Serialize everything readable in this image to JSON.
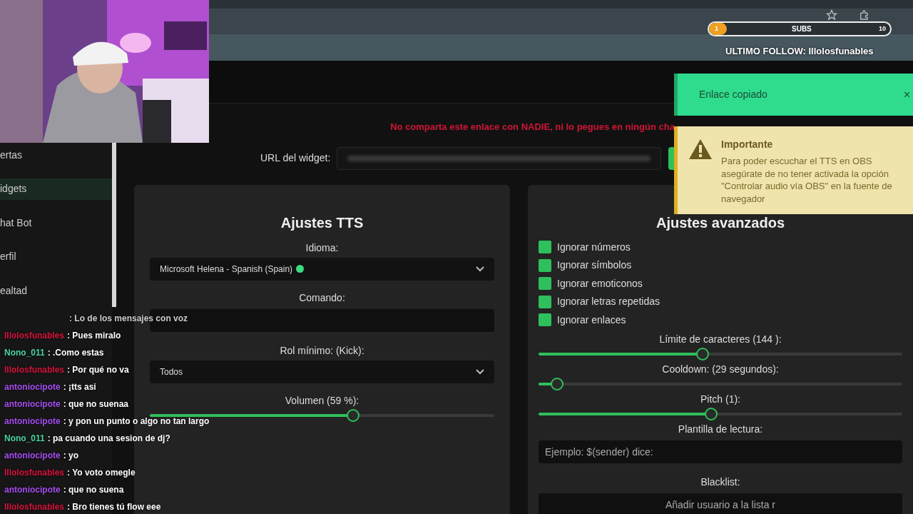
{
  "stream_overlay": {
    "subs": {
      "current": "1",
      "label": "SUBS",
      "goal": "10",
      "level": 0.1
    },
    "last_follow": "ULTIMO FOLLOW: Illolosfunables"
  },
  "sidebar": {
    "items": [
      {
        "label": "ertas",
        "selected": false
      },
      {
        "label": "idgets",
        "selected": true
      },
      {
        "label": "hat Bot",
        "selected": false
      },
      {
        "label": "erfil",
        "selected": false
      },
      {
        "label": "ealtad",
        "selected": false
      }
    ]
  },
  "warning_text": "No comparta este enlace con NADIE, ni lo pegues en ningún cha",
  "url_row": {
    "label": "URL del widget:"
  },
  "toasts": [
    {
      "kind": "success",
      "text": "Enlace copiado",
      "close": "×"
    },
    {
      "kind": "warning",
      "title": "Importante",
      "text": "Para poder escuchar el TTS en OBS asegúrate de no tener activada la opción \"Controlar audio vía OBS\" en la fuente de navegador"
    }
  ],
  "tts_card": {
    "title": "Ajustes TTS",
    "fields": [
      {
        "kind": "select",
        "label": "Idioma:",
        "value": "Microsoft Helena - Spanish (Spain)",
        "color": "#3ddc84"
      },
      {
        "kind": "input",
        "label": "Comando:"
      },
      {
        "kind": "select",
        "label": "Rol mínimo: (Kick):",
        "value": "Todos"
      },
      {
        "kind": "slider",
        "label": "Volumen (59 %):",
        "level": 0.59
      }
    ]
  },
  "advanced_card": {
    "title": "Ajustes avanzados",
    "options": [
      {
        "label": "Ignorar números",
        "checked": true
      },
      {
        "label": "Ignorar símbolos",
        "checked": true
      },
      {
        "label": "Ignorar emoticonos",
        "checked": true
      },
      {
        "label": "Ignorar letras repetidas",
        "checked": true
      },
      {
        "label": "Ignorar enlaces",
        "checked": true
      }
    ],
    "fields": [
      {
        "kind": "slider",
        "label": "Límite de caracteres (144 ):",
        "level": 0.45
      },
      {
        "kind": "slider",
        "label": "Cooldown: (29 segundos):",
        "level": 0.05
      },
      {
        "kind": "slider",
        "label": "Pitch (1):",
        "level": 0.475
      },
      {
        "kind": "input",
        "label": "Plantilla de lectura:",
        "placeholder": "Ejemplo: $(sender) dice:"
      },
      {
        "kind": "list_input",
        "label": "Blacklist:",
        "placeholder": "Añadir usuario a la lista r"
      }
    ]
  },
  "chat": [
    {
      "text": ": Lo de los mensajes con voz"
    },
    {
      "user": "Illolosfunables",
      "color": "#d8143e",
      "text": ": Pues miralo"
    },
    {
      "user": "Nono_011",
      "color": "#4ad6a0",
      "text": ": .Como estas"
    },
    {
      "user": "Illolosfunables",
      "color": "#d8143e",
      "text": ": Por qué no va"
    },
    {
      "user": "antoniocipote",
      "color": "#a64ff0",
      "text": ": ¡tts asi"
    },
    {
      "user": "antoniocipote",
      "color": "#a64ff0",
      "text": ": que no suenaa"
    },
    {
      "user": "antoniocipote",
      "color": "#a64ff0",
      "text": ": y pon un punto o algo no tan largo"
    },
    {
      "user": "Nono_011",
      "color": "#4ad6a0",
      "text": ": pa cuando una sesion de dj?"
    },
    {
      "user": "antoniocipote",
      "color": "#a64ff0",
      "text": ": yo"
    },
    {
      "user": "Illolosfunables",
      "color": "#d8143e",
      "text": ": Yo voto omegle"
    },
    {
      "user": "antoniocipote",
      "color": "#a64ff0",
      "text": ": que no suena"
    },
    {
      "user": "Illolosfunables",
      "color": "#d8143e",
      "text": ": Bro tienes tú flow eee"
    }
  ]
}
